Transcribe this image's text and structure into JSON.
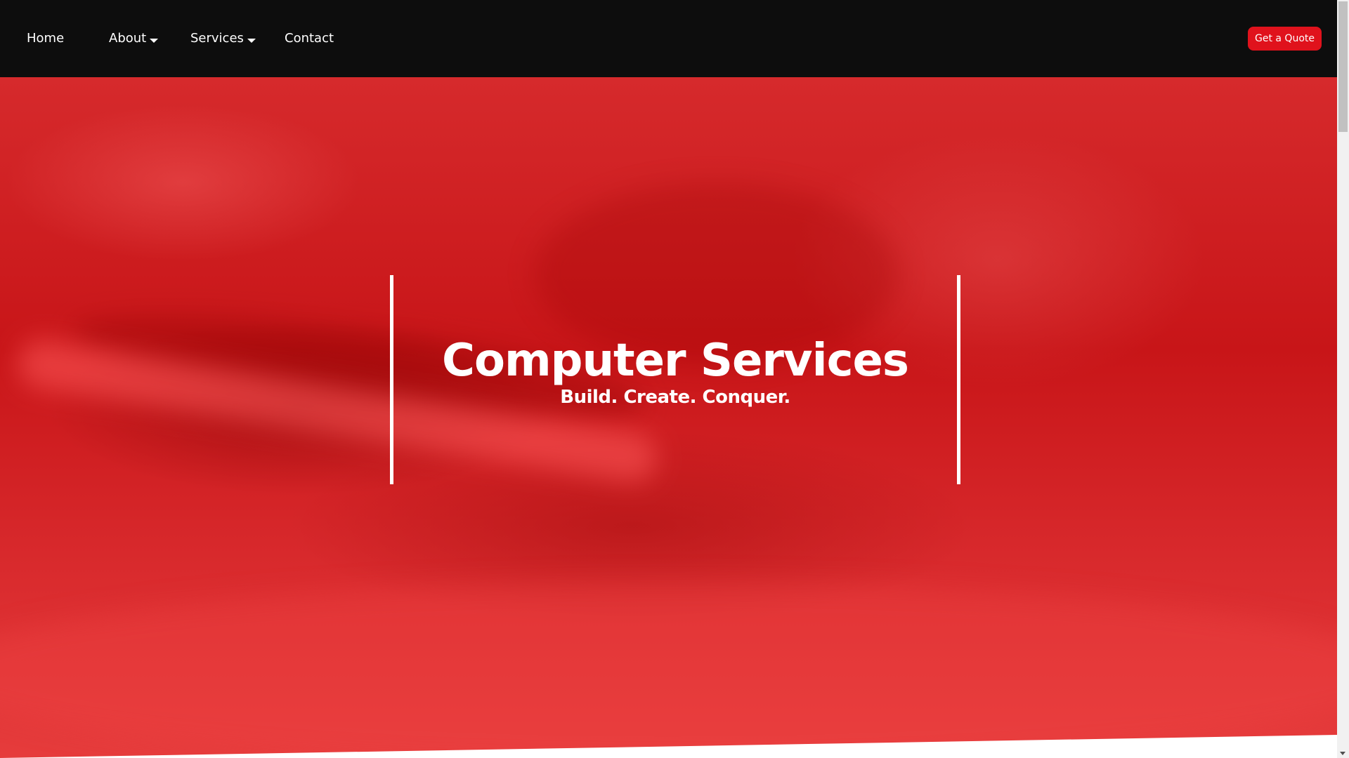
{
  "nav": {
    "items": [
      {
        "label": "Home",
        "has_dropdown": false
      },
      {
        "label": "About",
        "has_dropdown": true
      },
      {
        "label": "Services",
        "has_dropdown": true
      },
      {
        "label": "Contact",
        "has_dropdown": false
      }
    ],
    "cta_label": "Get a Quote"
  },
  "hero": {
    "title": "Computer Services",
    "subtitle": "Build. Create. Conquer."
  },
  "colors": {
    "nav_background": "#0d0d0d",
    "accent": "#e0121c",
    "hero_overlay": "#c81518",
    "text": "#ffffff"
  },
  "icons": {
    "dropdown": "caret-down-icon",
    "scroll_down": "scroll-down-arrow-icon"
  }
}
